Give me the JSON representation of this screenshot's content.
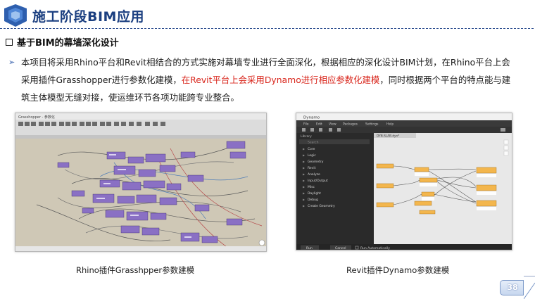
{
  "header": {
    "title": "施工阶段BIM应用"
  },
  "section": {
    "title": "基于BIM的幕墙深化设计"
  },
  "paragraph": {
    "part1": "本项目将采用Rhino平台和Revit相结合的方式实施对幕墙专业进行全面深化，根据相应的深化设计BIM计划，在Rhino平台上会采用插件Grasshopper进行参数化建模，",
    "part2_highlight": "在Revit平台上会采用Dynamo进行相应参数化建模",
    "part3": "，同时根据两个平台的特点能与建筑主体模型无缝对接，使运维环节各项功能跨专业整合。"
  },
  "screenshots": {
    "left": {
      "window_title": "Grasshopper - 参数化",
      "caption": "Rhino插件Grasshpper参数建模"
    },
    "right": {
      "window_title": "Dynamo",
      "menu": [
        "File",
        "Edit",
        "View",
        "Packages",
        "Settings",
        "Help"
      ],
      "tab": "DYN-SLAB.dyn*",
      "library_label": "Library",
      "search_placeholder": "Search",
      "library_items": [
        "Core",
        "Logic",
        "Geometry",
        "Revit",
        "Analyze",
        "Input/Output",
        "Misc",
        "Daylight",
        "Debug",
        "Create Geometry"
      ],
      "run_button": "Run",
      "cancel_button": "Cancel",
      "run_auto": "Run Automatically",
      "caption": "Revit插件Dynamo参数建模"
    }
  },
  "page": {
    "number": "38"
  },
  "colors": {
    "title_blue": "#1b3f80",
    "highlight_red": "#d9261c",
    "bullet_blue": "#2b57a8"
  }
}
